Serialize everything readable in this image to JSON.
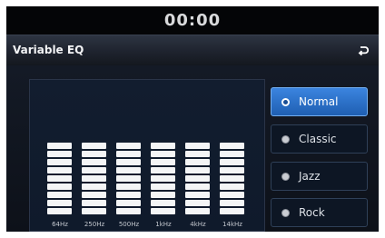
{
  "status": {
    "clock": "00:00"
  },
  "header": {
    "title": "Variable EQ",
    "back_icon": "back-arrow-icon"
  },
  "equalizer": {
    "bands": [
      {
        "label": "64Hz",
        "level_segments": 9,
        "max_segments": 9
      },
      {
        "label": "250Hz",
        "level_segments": 9,
        "max_segments": 9
      },
      {
        "label": "500Hz",
        "level_segments": 9,
        "max_segments": 9
      },
      {
        "label": "1kHz",
        "level_segments": 9,
        "max_segments": 9
      },
      {
        "label": "4kHz",
        "level_segments": 9,
        "max_segments": 9
      },
      {
        "label": "14kHz",
        "level_segments": 9,
        "max_segments": 9
      }
    ]
  },
  "presets": {
    "selected": "Normal",
    "items": [
      {
        "label": "Normal"
      },
      {
        "label": "Classic"
      },
      {
        "label": "Jazz"
      },
      {
        "label": "Rock"
      }
    ]
  },
  "colors": {
    "accent": "#2f74cf",
    "segment": "#f4f5f6",
    "background": "#0a0d12"
  }
}
